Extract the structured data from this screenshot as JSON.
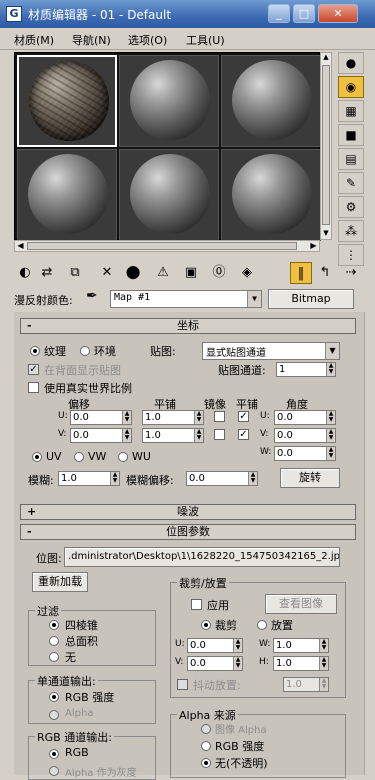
{
  "window": {
    "title": "材质编辑器 - 01 - Default",
    "min": "_",
    "max": "□",
    "close": "✕"
  },
  "menu": [
    "材质(M)",
    "导航(N)",
    "选项(O)",
    "工具(U)"
  ],
  "diffuse": {
    "label": "漫反射颜色:",
    "map": "Map #1",
    "type_button": "Bitmap"
  },
  "coords": {
    "header": "坐标",
    "texture": "纹理",
    "env": "环境",
    "mapping_label": "贴图:",
    "mapping": "显式贴图通道",
    "show_back": "在背面显示贴图",
    "map_channel_label": "贴图通道:",
    "map_channel": "1",
    "real_world": "使用真实世界比例",
    "offset": "偏移",
    "tiling": "平铺",
    "mirror": "镜像",
    "tile": "平铺",
    "angle": "角度",
    "u_off": "0.0",
    "v_off": "0.0",
    "u_tile": "1.0",
    "v_tile": "1.0",
    "u_ang": "0.0",
    "v_ang": "0.0",
    "w_ang": "0.0",
    "U": "U:",
    "V": "V:",
    "W": "W:",
    "uv": "UV",
    "vw": "VW",
    "wu": "WU",
    "blur_label": "模糊:",
    "blur": "1.0",
    "blur_off_label": "模糊偏移:",
    "blur_off": "0.0",
    "rotate": "旋转"
  },
  "noise": {
    "header": "噪波"
  },
  "bitmap": {
    "header": "位图参数",
    "path_label": "位图:",
    "path": ".dministrator\\Desktop\\1\\1628220_154750342165_2.jpg",
    "reload": "重新加载",
    "crop_title": "裁剪/放置",
    "apply": "应用",
    "view_image": "查看图像",
    "crop": "裁剪",
    "place": "放置",
    "u": "0.0",
    "v": "0.0",
    "w": "1.0",
    "h": "1.0",
    "W_lbl": "W:",
    "H_lbl": "H:",
    "jitter": "抖动放置:",
    "jitter_val": "1.0",
    "filter_title": "过滤",
    "pyramidal": "四棱锥",
    "summed": "总面积",
    "none": "无",
    "mono_title": "单通道输出:",
    "rgb_int": "RGB 强度",
    "alpha": "Alpha",
    "rgb_title": "RGB 通道输出:",
    "rgb": "RGB",
    "alpha_gray": "Alpha 作为灰度",
    "alpha_src_title": "Alpha 来源",
    "img_alpha": "图像 Alpha",
    "rgb_int2": "RGB 强度",
    "none_opaque": "无(不透明)"
  },
  "colors": {
    "title_bar": "#3c6bb4",
    "active_toggle": "#f0c040"
  }
}
